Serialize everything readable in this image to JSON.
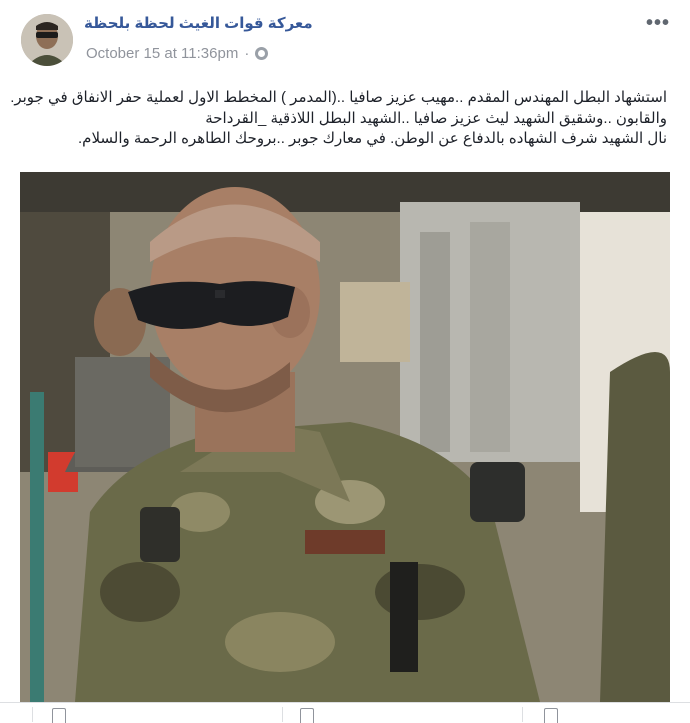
{
  "post": {
    "page_name": "معركة قوات الغيث لحظة بلحظة",
    "timestamp": "October 15 at 11:36pm",
    "privacy_icon": "globe-icon",
    "more_icon": "more-options-icon",
    "text_lines": [
      "استشهاد البطل المهندس المقدم ..مهيب عزيز صافيا ..(المدمر ) المخطط الاول لعملية حفر الانفاق في جوبر.",
      "والقابون ..وشقيق الشهيد ليث عزيز صافيا ..الشهيد البطل اللاذقية _القرداحة",
      "نال الشهيد شرف الشهاده بالدفاع عن الوطن. في معارك جوبر ..بروحك الطاهره الرحمة والسلام."
    ]
  },
  "footer": {
    "actions": [
      "like",
      "comment",
      "share"
    ]
  },
  "colors": {
    "link": "#365899",
    "meta": "#90949c",
    "text": "#1d2129"
  }
}
